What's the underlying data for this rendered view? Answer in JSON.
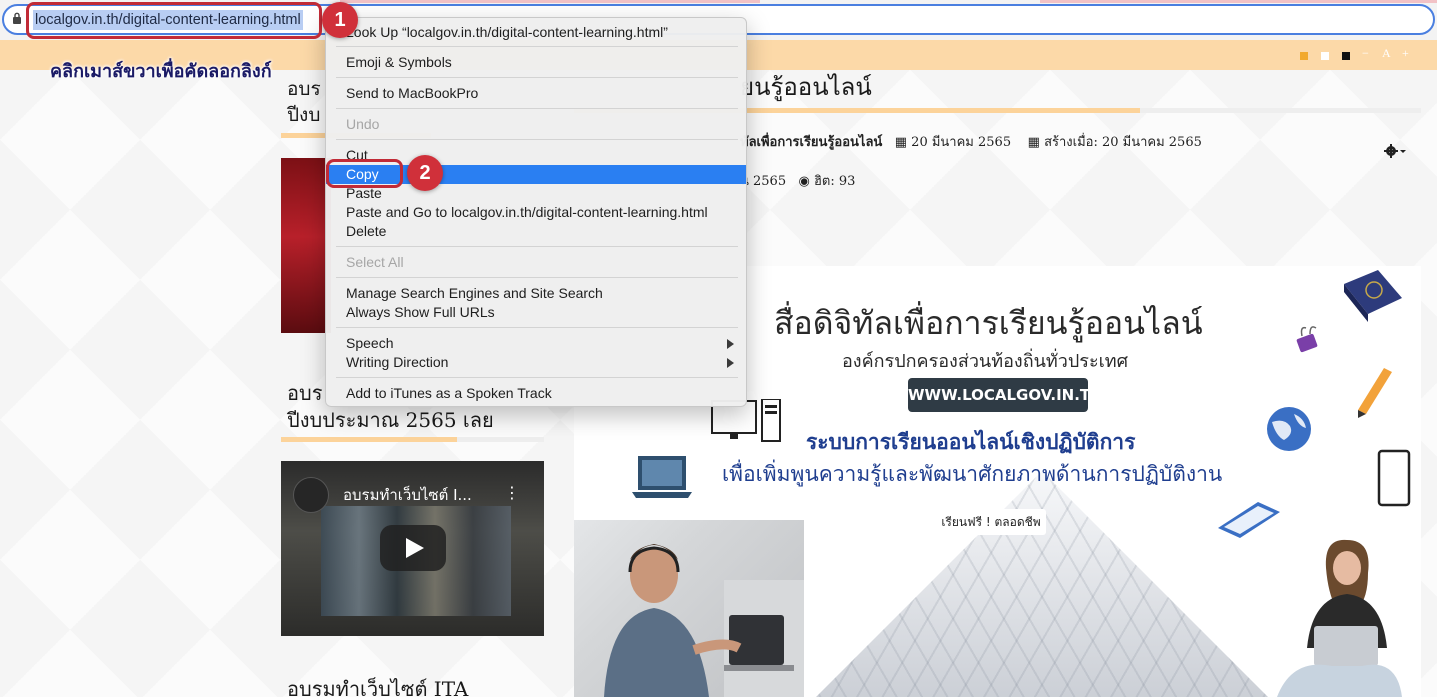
{
  "browser": {
    "url": "localgov.in.th/digital-content-learning.html"
  },
  "toolbar": {
    "tools": [
      "−",
      "A",
      "+"
    ]
  },
  "instruction": "คลิกเมาส์ขวาเพื่อคัดลอกลิงก์",
  "annotations": {
    "step1": "1",
    "step2": "2"
  },
  "context_menu": {
    "items": [
      {
        "label": "Look Up “localgov.in.th/digital-content-learning.html”",
        "enabled": true
      },
      {
        "label": "Emoji & Symbols",
        "enabled": true
      },
      {
        "label": "Send to MacBookPro",
        "enabled": true
      },
      {
        "label": "Undo",
        "enabled": false
      },
      {
        "label": "Cut",
        "enabled": true
      },
      {
        "label": "Copy",
        "enabled": true,
        "highlighted": true
      },
      {
        "label": "Paste",
        "enabled": true
      },
      {
        "label": "Paste and Go to localgov.in.th/digital-content-learning.html",
        "enabled": true
      },
      {
        "label": "Delete",
        "enabled": true
      },
      {
        "label": "Select All",
        "enabled": false
      },
      {
        "label": "Manage Search Engines and Site Search",
        "enabled": true
      },
      {
        "label": "Always Show Full URLs",
        "enabled": true
      },
      {
        "label": "Speech",
        "enabled": true,
        "submenu": true
      },
      {
        "label": "Writing Direction",
        "enabled": true,
        "submenu": true
      },
      {
        "label": "Add to iTunes as a Spoken Track",
        "enabled": true
      }
    ]
  },
  "sidebar": {
    "article1_title_line1": "อบร",
    "article1_title_line2": "ปีงบ",
    "article2_title_line1": "อบร",
    "article2_title_line2": "ปีงบประมาณ 2565 เลย",
    "video_title": "อบรมทำเว็บไซต์ I...",
    "article3_title": "อบรมทำเว็บไซต์ ITA"
  },
  "article": {
    "title_fragment": "ยนรู้ออนไลน์",
    "category": "ทัลเพื่อการเรียนรู้ออนไลน์",
    "published_date": "20 มีนาคม 2565",
    "created_label": "สร้างเมื่อ: 20 มีนาคม 2565",
    "modified_fragment": "น 2565",
    "hits": "ฮิต: 93"
  },
  "banner": {
    "title": "สื่อดิจิทัลเพื่อการเรียนรู้ออนไลน์",
    "subtitle": "องค์กรปกครองส่วนท้องถิ่นทั่วประเทศ",
    "url": "WWW.LOCALGOV.IN.TH",
    "line1": "ระบบการเรียนออนไลน์เชิงปฏิบัติการ",
    "line2": "เพื่อเพิ่มพูนความรู้และพัฒนาศักยภาพด้านการปฏิบัติงาน",
    "free": "เรียนฟรี ! ตลอดชีพ"
  },
  "colors": {
    "topbar": "#fcd9a8",
    "menu_highlight": "#2a7ff2",
    "annotation_red": "#c12b37",
    "banner_blue": "#1f3e8f"
  }
}
